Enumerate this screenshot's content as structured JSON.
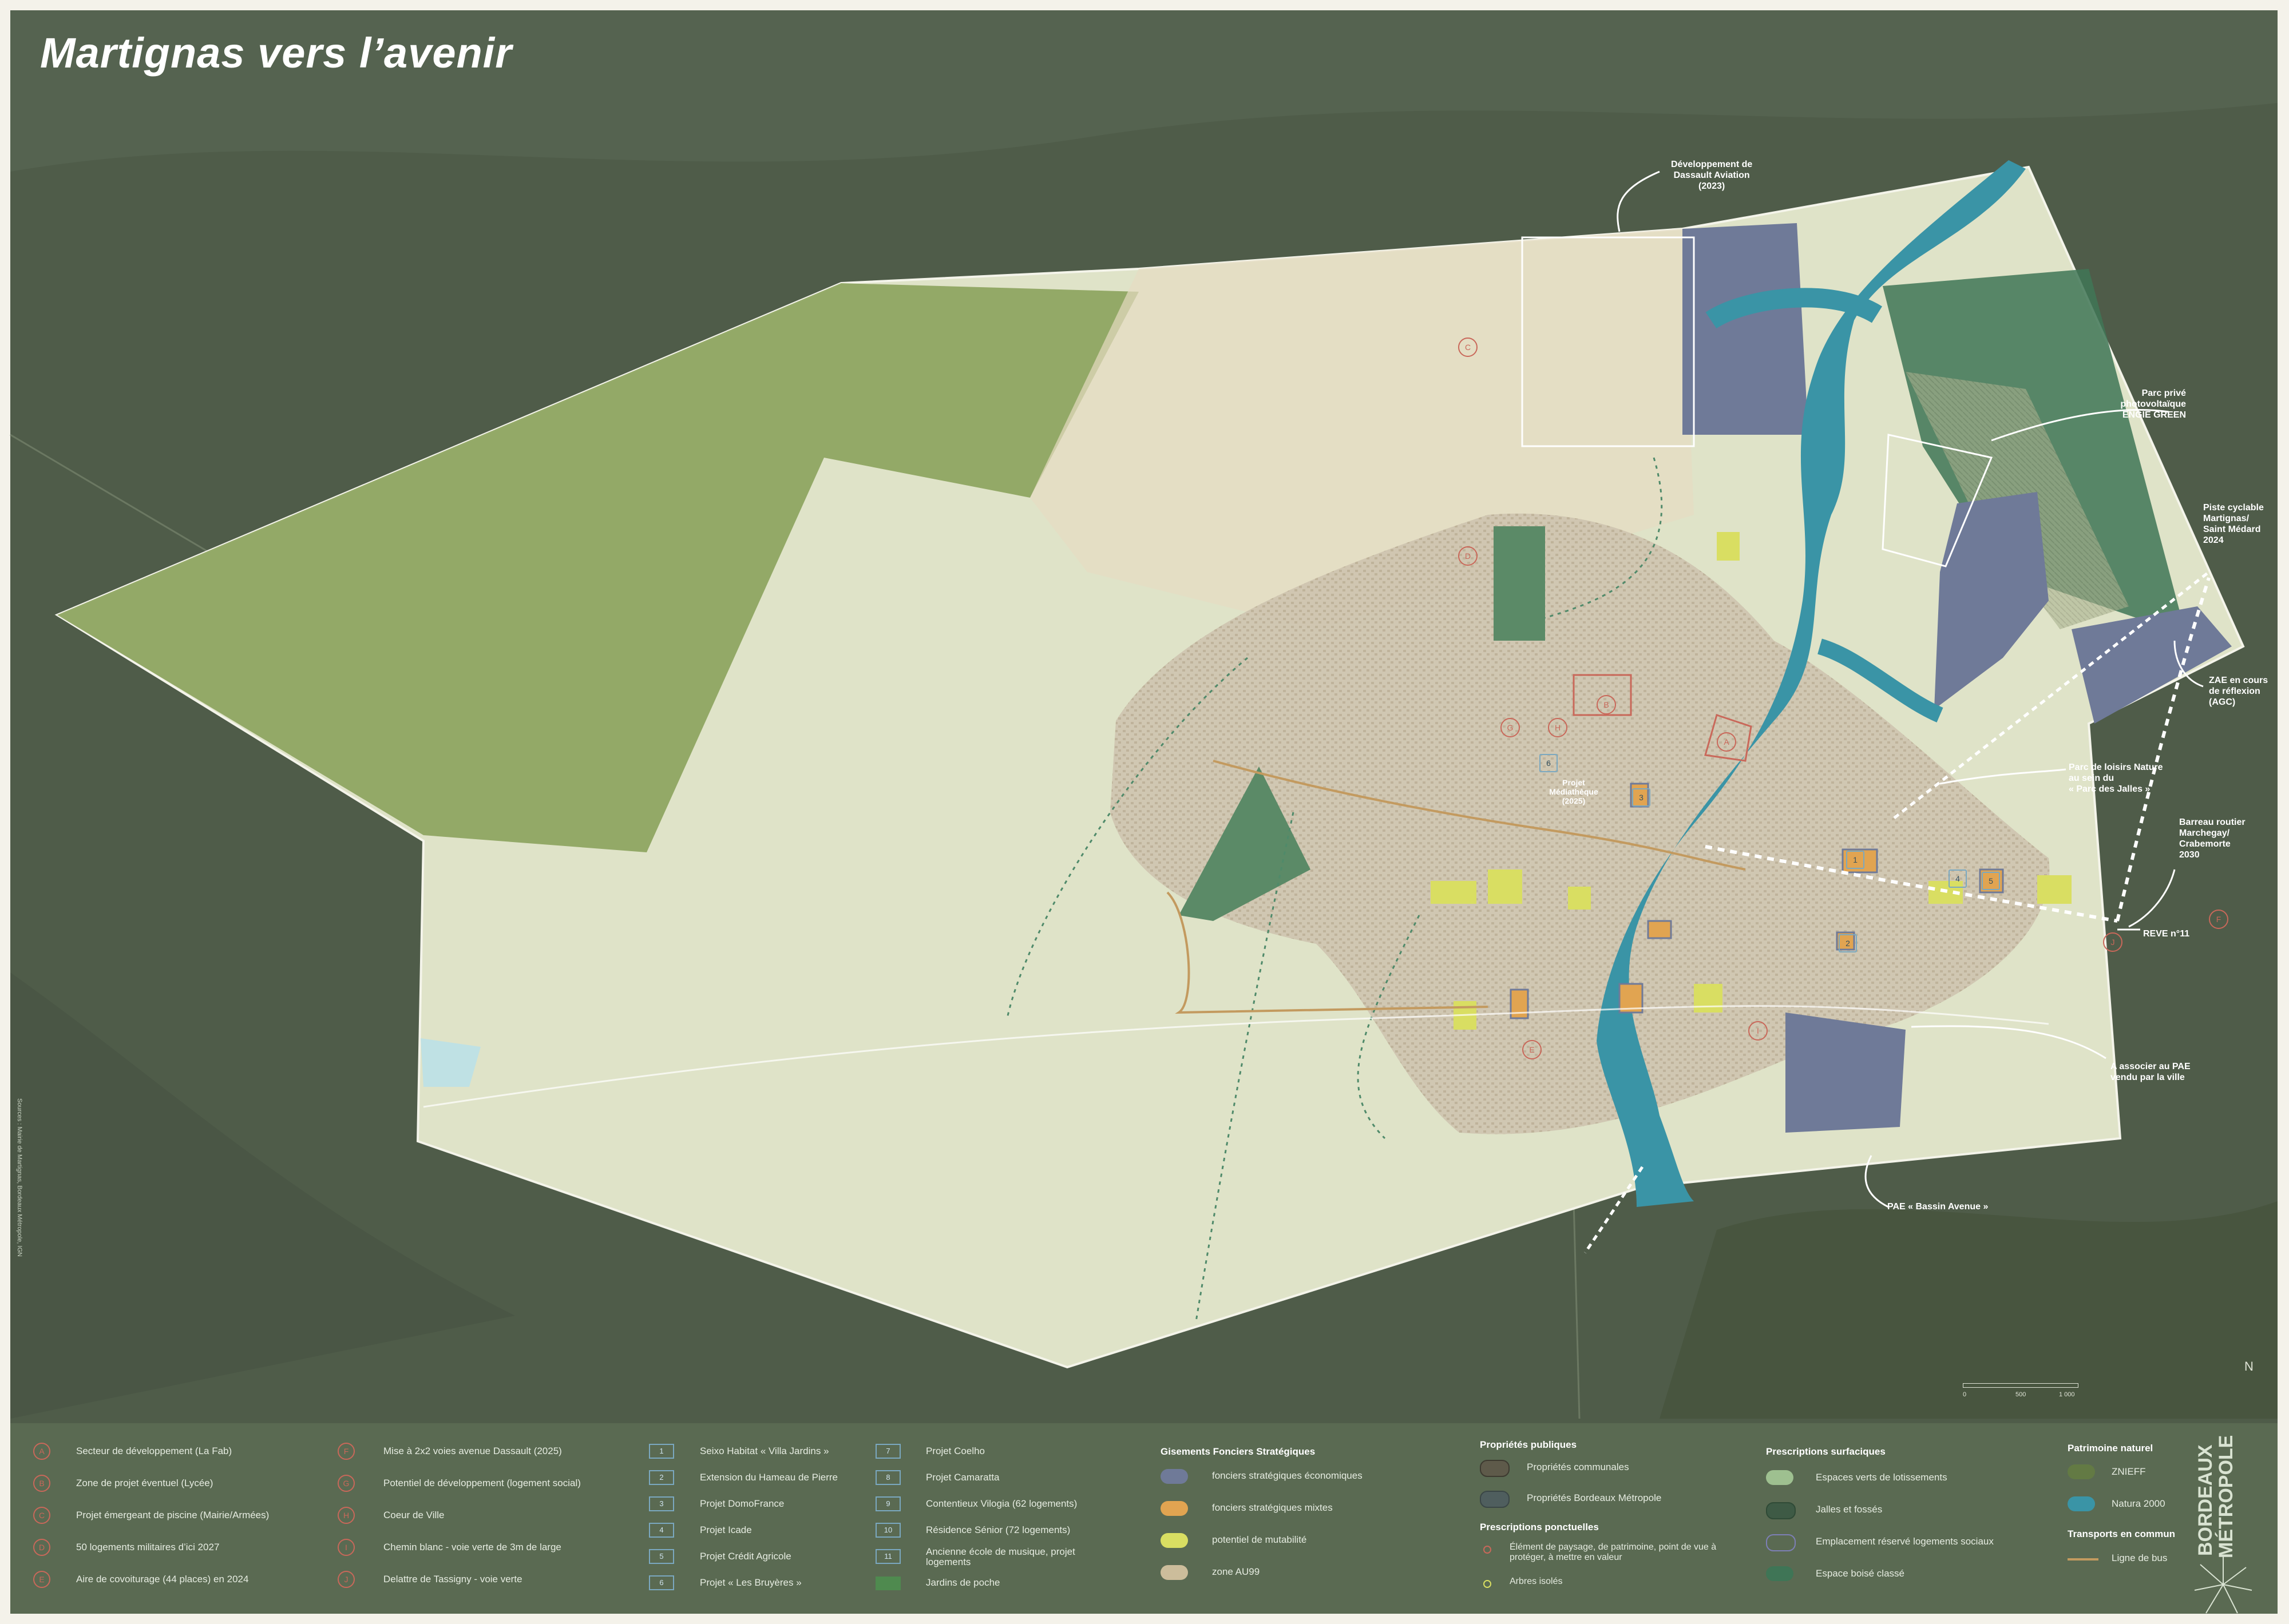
{
  "title": "Martignas vers l’avenir",
  "colors": {
    "background_relief": "#4f5c49",
    "commune_area": "#dfe3c8",
    "green_zone": "#869f56",
    "natura_2000": "#3a94a6",
    "znieff": "#637a44",
    "foncier_economique": "#6f7a98",
    "foncier_mixte": "#e1a451",
    "potentiel_mutabilite": "#d9de62",
    "zone_au99": "#ccbd9b",
    "espace_boise": "#3f7556",
    "legend_bg": "#5a6a52",
    "marker_circle": "#c9685a",
    "marker_box": "#7aa8c0"
  },
  "annotations": {
    "dassault": [
      "Développement de",
      "Dassault Aviation",
      "(2023)"
    ],
    "engie": [
      "Parc privé",
      "photovoltaïque",
      "ENGIE GREEN"
    ],
    "piste_cyclable": [
      "Piste cyclable",
      "Martignas/",
      "Saint Médard",
      "2024"
    ],
    "zae": [
      "ZAE en cours",
      "de réflexion",
      "(AGC)"
    ],
    "parc_loisirs": [
      "Parc de loisirs Nature",
      "au sein du",
      "« Parc des Jalles »"
    ],
    "barreau": [
      "Barreau routier",
      "Marchegay/",
      "Crabemorte",
      "2030"
    ],
    "reve": [
      "REVE n°11"
    ],
    "pae_vendu": [
      "A associer au PAE",
      "vendu par la ville"
    ],
    "pae_bassin": [
      "PAE « Bassin Avenue »"
    ],
    "mediatheque": [
      "Projet",
      "Médiathèque",
      "(2025)"
    ]
  },
  "map_letters": [
    "A",
    "B",
    "C",
    "D",
    "E",
    "F",
    "G",
    "H",
    "I",
    "J"
  ],
  "map_numbers": [
    "1",
    "2",
    "3",
    "4",
    "5",
    "6"
  ],
  "sources_vertical": "Sources : Mairie de Martignas, Bordeaux Métropole, IGN",
  "scale_labels": [
    "0",
    "500",
    "1 000"
  ],
  "north": "N",
  "legend": {
    "letters": [
      {
        "k": "A",
        "t": "Secteur de développement (La Fab)"
      },
      {
        "k": "B",
        "t": "Zone de projet éventuel (Lycée)"
      },
      {
        "k": "C",
        "t": "Projet émergeant de piscine (Mairie/Armées)"
      },
      {
        "k": "D",
        "t": "50 logements militaires d’ici 2027"
      },
      {
        "k": "E",
        "t": "Aire de covoiturage (44 places) en 2024"
      },
      {
        "k": "F",
        "t": "Mise à 2x2 voies avenue Dassault (2025)"
      },
      {
        "k": "G",
        "t": "Potentiel de développement (logement social)"
      },
      {
        "k": "H",
        "t": "Coeur de Ville"
      },
      {
        "k": "I",
        "t": "Chemin blanc - voie verte de 3m de large"
      },
      {
        "k": "J",
        "t": "Delattre de Tassigny - voie verte"
      }
    ],
    "projects": [
      {
        "k": "1",
        "t": "Seixo Habitat « Villa Jardins »"
      },
      {
        "k": "2",
        "t": "Extension du Hameau de Pierre"
      },
      {
        "k": "3",
        "t": "Projet DomoFrance"
      },
      {
        "k": "4",
        "t": "Projet Icade"
      },
      {
        "k": "5",
        "t": "Projet Crédit Agricole"
      },
      {
        "k": "6",
        "t": "Projet « Les Bruyères »"
      },
      {
        "k": "7",
        "t": "Projet Coelho"
      },
      {
        "k": "8",
        "t": "Projet Camaratta"
      },
      {
        "k": "9",
        "t": "Contentieux Vilogia (62 logements)"
      },
      {
        "k": "10",
        "t": "Résidence Sénior (72 logements)"
      },
      {
        "k": "11",
        "t": "Ancienne école de musique, projet logements"
      },
      {
        "k": "",
        "t": "Jardins de poche"
      }
    ],
    "gisements": {
      "title": "Gisements Fonciers Stratégiques",
      "items": [
        "fonciers stratégiques économiques",
        "fonciers stratégiques mixtes",
        "potentiel de mutabilité",
        "zone AU99"
      ]
    },
    "proprietes": {
      "title": "Propriétés publiques",
      "items": [
        "Propriétés communales",
        "Propriétés Bordeaux Métropole"
      ]
    },
    "ponctuelles": {
      "title": "Prescriptions ponctuelles",
      "items": [
        "Élément de paysage, de patrimoine, point de vue à protéger, à mettre en valeur",
        "Arbres isolés"
      ]
    },
    "surfaciques": {
      "title": "Prescriptions surfaciques",
      "items": [
        "Espaces verts de lotissements",
        "Jalles et fossés",
        "Emplacement réservé logements sociaux",
        "Espace boisé classé"
      ]
    },
    "patrimoine": {
      "title": "Patrimoine naturel",
      "items": [
        "ZNIEFF",
        "Natura 2000"
      ]
    },
    "transports": {
      "title": "Transports en commun",
      "items": [
        "Ligne de bus"
      ]
    }
  },
  "logo": [
    "BORDEAUX",
    "MÉTROPOLE"
  ]
}
